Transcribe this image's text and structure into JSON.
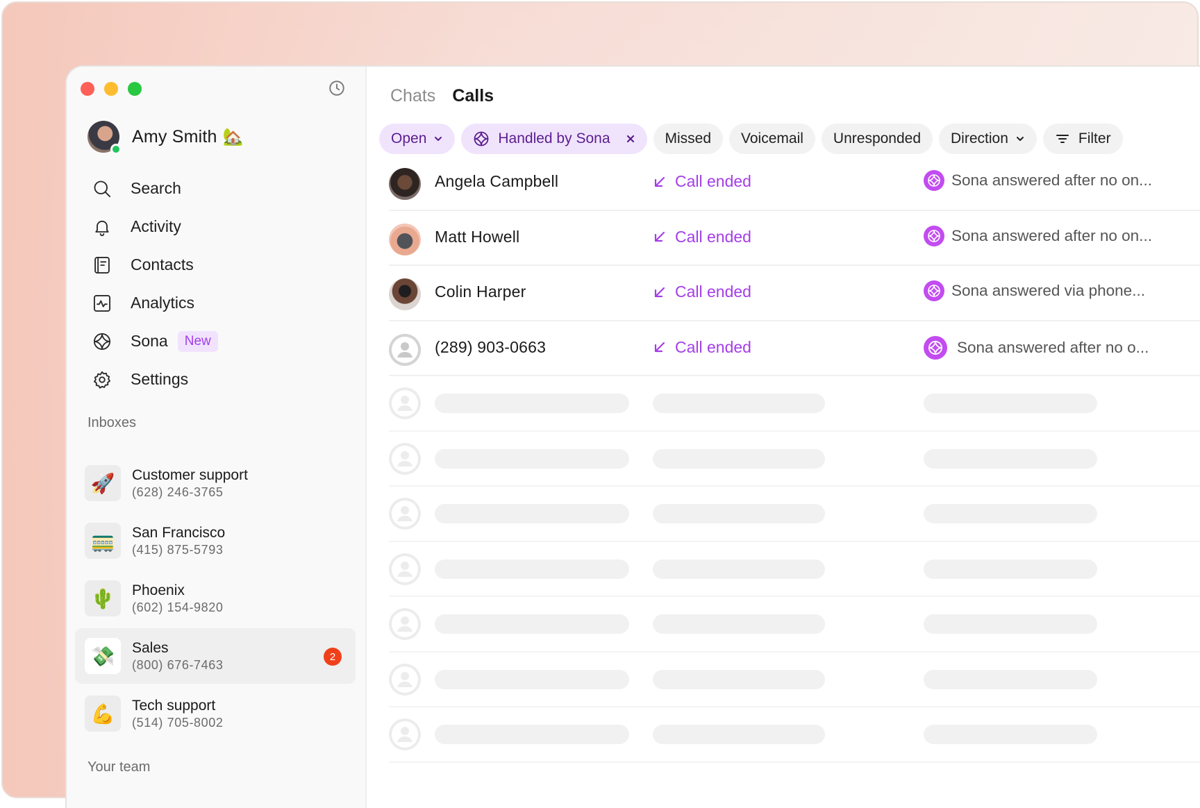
{
  "profile": {
    "name": "Amy Smith",
    "emoji": "🏡"
  },
  "nav": [
    {
      "label": "Search",
      "icon": "search-icon"
    },
    {
      "label": "Activity",
      "icon": "bell-icon"
    },
    {
      "label": "Contacts",
      "icon": "contacts-icon"
    },
    {
      "label": "Analytics",
      "icon": "analytics-icon"
    },
    {
      "label": "Sona",
      "icon": "sona-icon",
      "badge": "New"
    },
    {
      "label": "Settings",
      "icon": "gear-icon"
    }
  ],
  "inboxes_label": "Inboxes",
  "inboxes": [
    {
      "name": "Customer support",
      "phone": "(628) 246-3765",
      "emoji": "🚀"
    },
    {
      "name": "San Francisco",
      "phone": "(415) 875-5793",
      "emoji": "🚃"
    },
    {
      "name": "Phoenix",
      "phone": "(602) 154-9820",
      "emoji": "🌵"
    },
    {
      "name": "Sales",
      "phone": "(800) 676-7463",
      "emoji": "💸",
      "count": "2"
    },
    {
      "name": "Tech support",
      "phone": "(514) 705-8002",
      "emoji": "💪"
    }
  ],
  "team_label": "Your team",
  "tabs": {
    "chats": "Chats",
    "calls": "Calls"
  },
  "chips": {
    "open": "Open",
    "handled": "Handled by Sona",
    "missed": "Missed",
    "voicemail": "Voicemail",
    "unresponded": "Unresponded",
    "direction": "Direction",
    "filter": "Filter"
  },
  "calls": [
    {
      "name": "Angela Campbell",
      "status": "Call ended",
      "desc": "Sona answered after no on..."
    },
    {
      "name": "Matt Howell",
      "status": "Call ended",
      "desc": "Sona answered after no on..."
    },
    {
      "name": "Colin Harper",
      "status": "Call ended",
      "desc": "Sona answered via phone..."
    },
    {
      "name": "(289) 903-0663",
      "status": "Call ended",
      "desc": "Sona answered after no o..."
    }
  ],
  "colors": {
    "accent": "#a43ee8",
    "chip_purple_bg": "#f0e4fd",
    "badge_red": "#f0401a"
  }
}
